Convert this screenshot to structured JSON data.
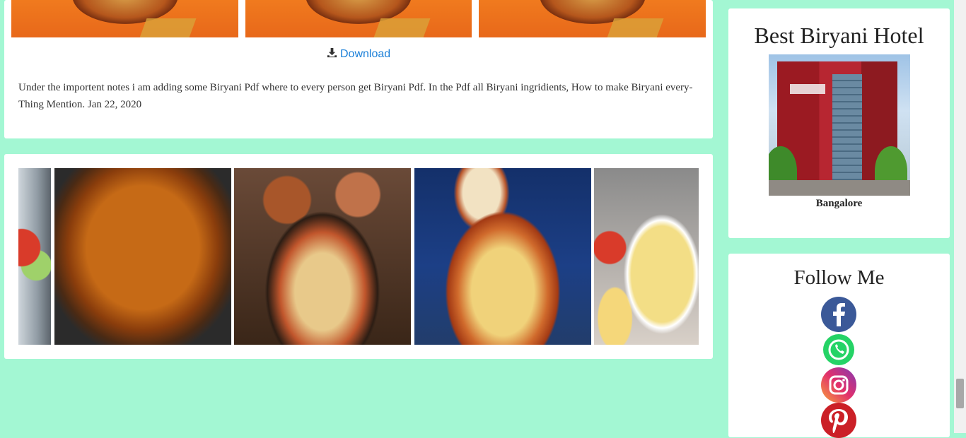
{
  "download": {
    "link_label": "Download",
    "notes": "Under the importent notes i am adding some Biryani Pdf where to every person get Biryani Pdf. In the Pdf all Biryani ingridients, How to make Biryani every-Thing Mention. Jan 22, 2020"
  },
  "sidebar": {
    "hotel": {
      "title": "Best Biryani Hotel",
      "caption": "Bangalore"
    },
    "follow": {
      "title": "Follow Me",
      "icons": [
        "facebook-icon",
        "whatsapp-icon",
        "instagram-icon",
        "pinterest-icon"
      ]
    }
  },
  "colors": {
    "background": "#a3f7d3",
    "link": "#1a7fd8",
    "facebook": "#3b5998",
    "whatsapp": "#25d366",
    "pinterest": "#cb2027"
  }
}
